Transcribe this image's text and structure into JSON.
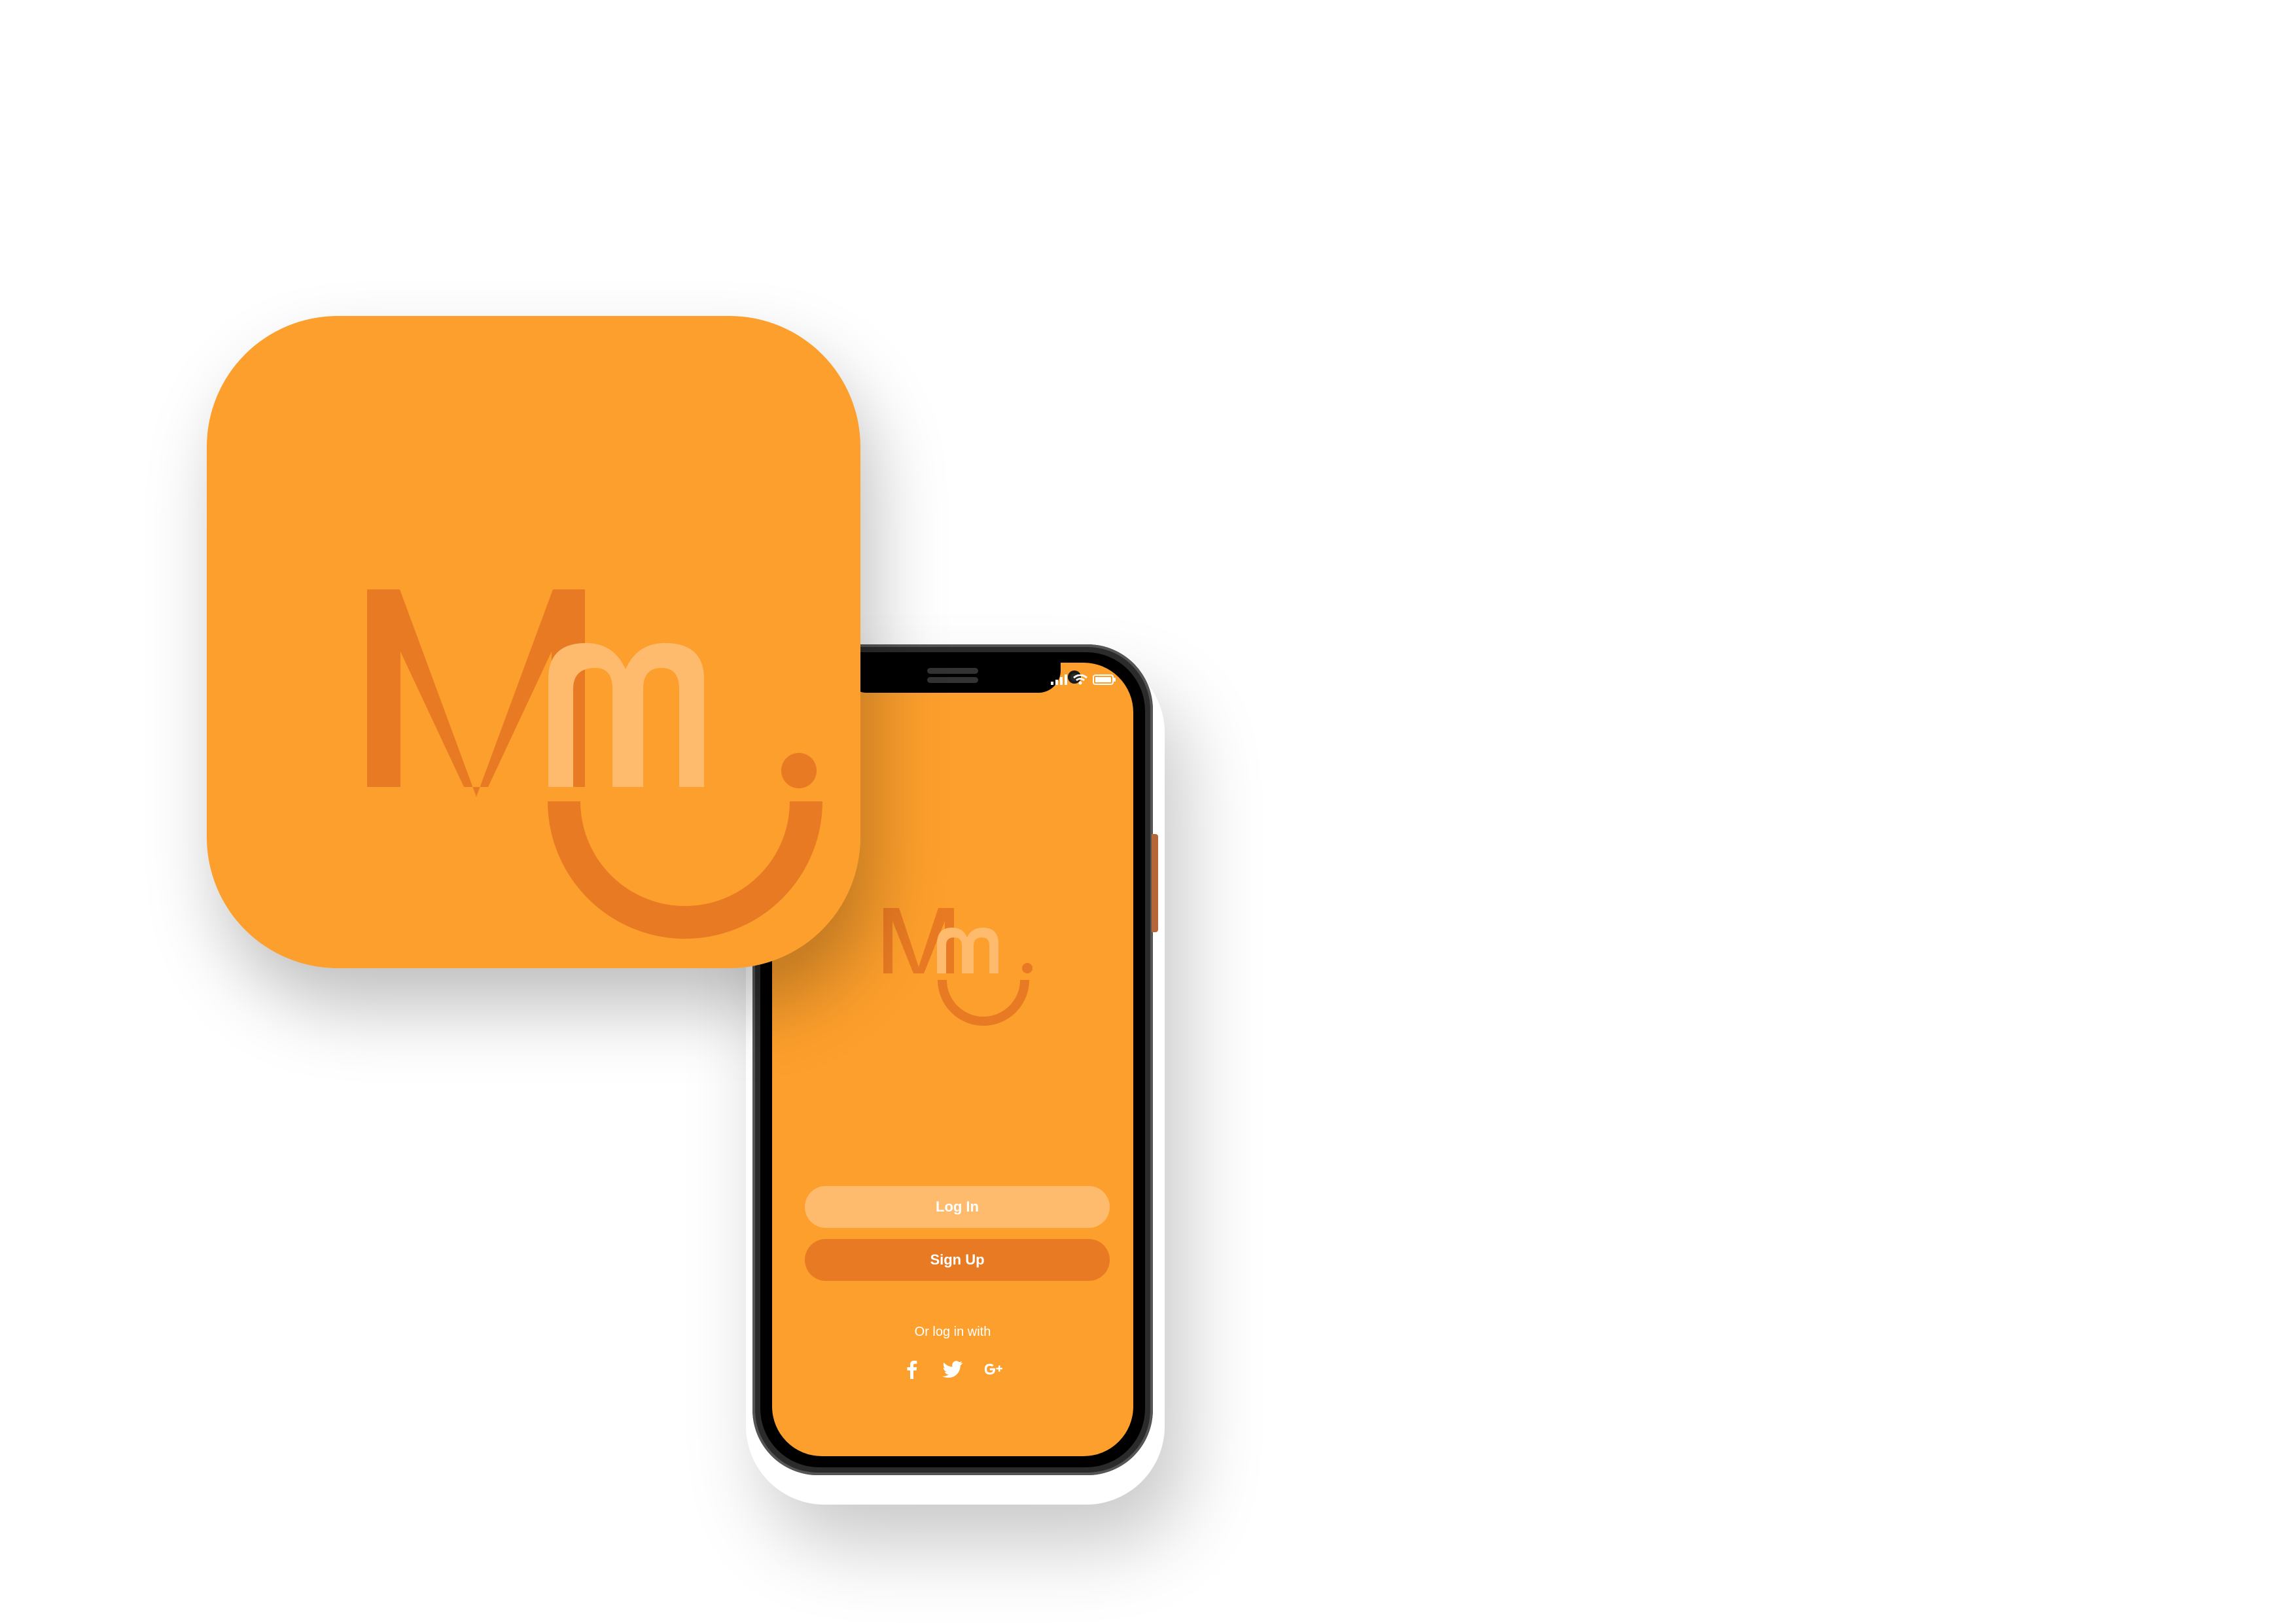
{
  "colors": {
    "brand_orange": "#fd9f2c",
    "dark_orange": "#e87a23",
    "light_orange": "#ffbb6d",
    "white": "#ffffff",
    "phone_frame": "#2b2b2b"
  },
  "app_icon": {
    "icon": "mm-smile-logo"
  },
  "phone": {
    "status_bar": {
      "icons": [
        "signal-icon",
        "wifi-icon",
        "battery-icon"
      ]
    },
    "screen": {
      "logo": "mm-smile-logo",
      "login_label": "Log In",
      "signup_label": "Sign Up",
      "alt_login_text": "Or log in with",
      "social": [
        "facebook-icon",
        "twitter-icon",
        "google-plus-icon"
      ]
    }
  }
}
